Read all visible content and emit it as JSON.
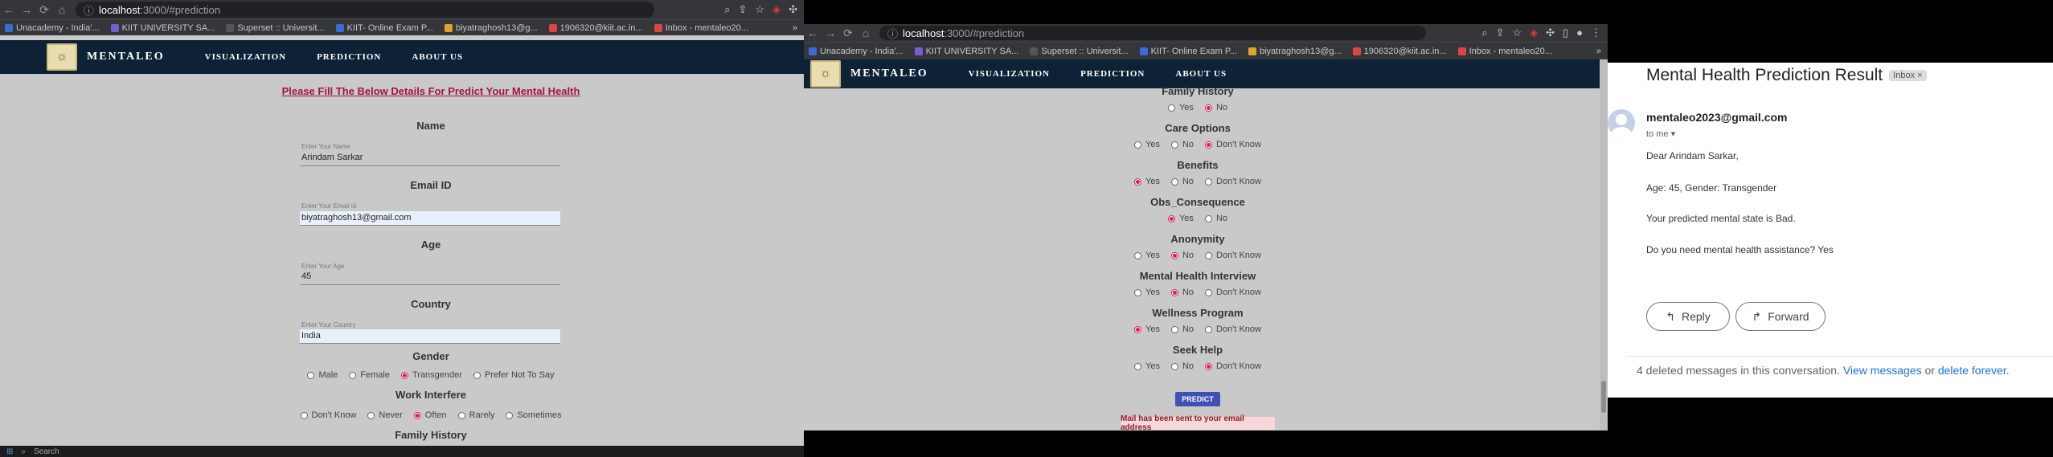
{
  "browser": {
    "url_host": "localhost",
    "url_path": ":3000/#prediction",
    "bookmarks": [
      "Unacademy - India'...",
      "KIIT UNIVERSITY SA...",
      "Superset :: Universit...",
      "KIIT- Online Exam P...",
      "biyatraghosh13@g...",
      "1906320@kiit.ac.in...",
      "Inbox - mentaleo20..."
    ]
  },
  "app": {
    "brand": "MENTALEO",
    "nav": [
      "VISUALIZATION",
      "PREDICTION",
      "ABOUT US"
    ]
  },
  "left_form": {
    "heading": "Please Fill The Below Details For Predict Your Mental Health",
    "name": {
      "title": "Name",
      "label": "Enter Your Name",
      "value": "Arindam Sarkar"
    },
    "email": {
      "title": "Email ID",
      "label": "Enter Your Email id",
      "value": "biyatraghosh13@gmail.com"
    },
    "age": {
      "title": "Age",
      "label": "Enter Your Age",
      "value": "45"
    },
    "country": {
      "title": "Country",
      "label": "Enter Your Country",
      "value": "India"
    },
    "gender": {
      "title": "Gender",
      "options": [
        "Male",
        "Female",
        "Transgender",
        "Prefer Not To Say"
      ],
      "selected": 2
    },
    "work": {
      "title": "Work Interfere",
      "options": [
        "Don't Know",
        "Never",
        "Often",
        "Rarely",
        "Sometimes"
      ],
      "selected": 2
    },
    "family_title": "Family History"
  },
  "right_form": {
    "questions": [
      {
        "title": "Family History",
        "options": [
          "Yes",
          "No"
        ],
        "selected": 1
      },
      {
        "title": "Care Options",
        "options": [
          "Yes",
          "No",
          "Don't Know"
        ],
        "selected": 2
      },
      {
        "title": "Benefits",
        "options": [
          "Yes",
          "No",
          "Don't Know"
        ],
        "selected": 0
      },
      {
        "title": "Obs_Consequence",
        "options": [
          "Yes",
          "No"
        ],
        "selected": 0
      },
      {
        "title": "Anonymity",
        "options": [
          "Yes",
          "No",
          "Don't Know"
        ],
        "selected": 1
      },
      {
        "title": "Mental Health Interview",
        "options": [
          "Yes",
          "No",
          "Don't Know"
        ],
        "selected": 1
      },
      {
        "title": "Wellness Program",
        "options": [
          "Yes",
          "No",
          "Don't Know"
        ],
        "selected": 0
      },
      {
        "title": "Seek Help",
        "options": [
          "Yes",
          "No",
          "Don't Know"
        ],
        "selected": 2
      }
    ],
    "predict_label": "PREDICT",
    "mail_notice": "Mail has been sent to your email address"
  },
  "email": {
    "subject": "Mental Health Prediction Result",
    "badge": "Inbox",
    "sender": "mentaleo2023@gmail.com",
    "to": "to me",
    "greeting": "Dear Arindam Sarkar,",
    "line1": "Age: 45, Gender: Transgender",
    "line2": "Your predicted mental state is Bad.",
    "line3": "Do you need mental health assistance? Yes",
    "reply": "Reply",
    "forward": "Forward",
    "deleted_text": "4 deleted messages in this conversation.",
    "view_link": "View messages",
    "or": "or",
    "delete_link": "delete forever."
  },
  "taskbar": {
    "search": "Search"
  },
  "colors": {
    "nav": "#0d2236",
    "accent": "#d81b60",
    "predict": "#3f51b5",
    "link": "#1a73e8"
  }
}
